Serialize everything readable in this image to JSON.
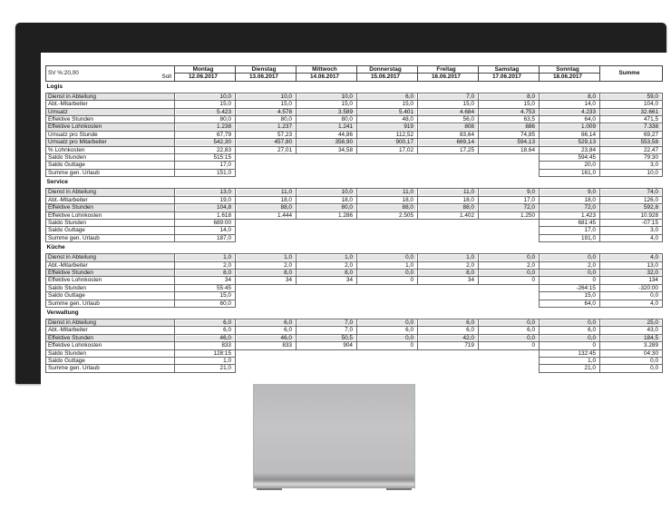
{
  "header": {
    "sv_label": "SV %:20,00",
    "soll_label": "Soll",
    "days": [
      {
        "name": "Montag",
        "date": "12.06.2017"
      },
      {
        "name": "Dienstag",
        "date": "13.06.2017"
      },
      {
        "name": "Mittwoch",
        "date": "14.06.2017"
      },
      {
        "name": "Donnerstag",
        "date": "15.06.2017"
      },
      {
        "name": "Freitag",
        "date": "16.06.2017"
      },
      {
        "name": "Samstag",
        "date": "17.06.2017"
      },
      {
        "name": "Sonntag",
        "date": "18.06.2017"
      }
    ],
    "sum_label": "Summe"
  },
  "sections": [
    {
      "title": "Logis",
      "rows": [
        {
          "label": "Dienst in Abteilung",
          "values": [
            "10,0",
            "10,0",
            "10,0",
            "6,0",
            "7,0",
            "8,0",
            "8,0",
            "59,0"
          ]
        },
        {
          "label": "Abt.-Mitarbeiter",
          "values": [
            "15,0",
            "15,0",
            "15,0",
            "15,0",
            "15,0",
            "15,0",
            "14,0",
            "104,0"
          ]
        },
        {
          "label": "Umsatz",
          "values": [
            "5.423",
            "4.578",
            "3.589",
            "5.401",
            "4.684",
            "4.753",
            "4.233",
            "32.661"
          ]
        },
        {
          "label": "Effektive Stunden",
          "values": [
            "80,0",
            "80,0",
            "80,0",
            "48,0",
            "56,0",
            "63,5",
            "64,0",
            "471,5"
          ]
        },
        {
          "label": "Effektive Lohnkosten",
          "values": [
            "1.238",
            "1.237",
            "1.241",
            "919",
            "808",
            "886",
            "1.009",
            "7.338"
          ]
        },
        {
          "label": "Umsatz pro Stunde",
          "values": [
            "67,79",
            "57,23",
            "44,86",
            "112,52",
            "83,64",
            "74,85",
            "66,14",
            "69,27"
          ]
        },
        {
          "label": "Umsatz pro Mitarbeiter",
          "values": [
            "542,30",
            "457,80",
            "358,90",
            "900,17",
            "669,14",
            "594,13",
            "529,13",
            "553,58"
          ]
        },
        {
          "label": "% Lohnkosten",
          "values": [
            "22,83",
            "27,01",
            "34,58",
            "17,02",
            "17,25",
            "18,64",
            "23,84",
            "22,47"
          ]
        }
      ],
      "saldo": [
        {
          "label": "Saldo Stunden",
          "soll": "515:15",
          "sonntag": "594:45",
          "summe": "79:30"
        },
        {
          "label": "Saldo Guttage",
          "soll": "17,0",
          "sonntag": "20,0",
          "summe": "3,0"
        },
        {
          "label": "Summe gen. Urlaub",
          "soll": "151,0",
          "sonntag": "161,0",
          "summe": "10,0"
        }
      ]
    },
    {
      "title": "Service",
      "rows": [
        {
          "label": "Dienst in Abteilung",
          "values": [
            "13,0",
            "11,0",
            "10,0",
            "11,0",
            "11,0",
            "9,0",
            "9,0",
            "74,0"
          ]
        },
        {
          "label": "Abt.-Mitarbeiter",
          "values": [
            "19,0",
            "18,0",
            "18,0",
            "18,0",
            "18,0",
            "17,0",
            "18,0",
            "126,0"
          ]
        },
        {
          "label": "Effektive Stunden",
          "values": [
            "104,8",
            "88,0",
            "80,0",
            "88,0",
            "88,0",
            "72,0",
            "72,0",
            "592,8"
          ]
        },
        {
          "label": "Effektive Lohnkosten",
          "values": [
            "1.618",
            "1.444",
            "1.286",
            "2.505",
            "1.402",
            "1.250",
            "1.423",
            "10.928"
          ]
        }
      ],
      "saldo": [
        {
          "label": "Saldo Stunden",
          "soll": "689:00",
          "sonntag": "681:45",
          "summe": "-07:15"
        },
        {
          "label": "Saldo Guttage",
          "soll": "14,0",
          "sonntag": "17,0",
          "summe": "3,0"
        },
        {
          "label": "Summe gen. Urlaub",
          "soll": "187,0",
          "sonntag": "191,0",
          "summe": "4,0"
        }
      ]
    },
    {
      "title": "Küche",
      "rows": [
        {
          "label": "Dienst in Abteilung",
          "values": [
            "1,0",
            "1,0",
            "1,0",
            "0,0",
            "1,0",
            "0,0",
            "0,0",
            "4,0"
          ]
        },
        {
          "label": "Abt.-Mitarbeiter",
          "values": [
            "2,0",
            "2,0",
            "2,0",
            "1,0",
            "2,0",
            "2,0",
            "2,0",
            "13,0"
          ]
        },
        {
          "label": "Effektive Stunden",
          "values": [
            "8,0",
            "8,0",
            "8,0",
            "0,0",
            "8,0",
            "0,0",
            "0,0",
            "32,0"
          ]
        },
        {
          "label": "Effektive Lohnkosten",
          "values": [
            "34",
            "34",
            "34",
            "0",
            "34",
            "0",
            "0",
            "134"
          ]
        }
      ],
      "saldo": [
        {
          "label": "Saldo Stunden",
          "soll": "55:45",
          "sonntag": "-264:15",
          "summe": "-320:00"
        },
        {
          "label": "Saldo Guttage",
          "soll": "15,0",
          "sonntag": "15,0",
          "summe": "0,0"
        },
        {
          "label": "Summe gen. Urlaub",
          "soll": "60,0",
          "sonntag": "64,0",
          "summe": "4,0"
        }
      ]
    },
    {
      "title": "Verwaltung",
      "rows": [
        {
          "label": "Dienst in Abteilung",
          "values": [
            "6,0",
            "6,0",
            "7,0",
            "0,0",
            "6,0",
            "0,0",
            "0,0",
            "25,0"
          ]
        },
        {
          "label": "Abt.-Mitarbeiter",
          "values": [
            "6,0",
            "6,0",
            "7,0",
            "6,0",
            "6,0",
            "6,0",
            "6,0",
            "43,0"
          ]
        },
        {
          "label": "Effektive Stunden",
          "values": [
            "46,0",
            "46,0",
            "50,5",
            "0,0",
            "42,0",
            "0,0",
            "0,0",
            "184,5"
          ]
        },
        {
          "label": "Effektive Lohnkosten",
          "values": [
            "833",
            "833",
            "904",
            "0",
            "719",
            "0",
            "0",
            "3.289"
          ]
        }
      ],
      "saldo": [
        {
          "label": "Saldo Stunden",
          "soll": "128:15",
          "sonntag": "132:45",
          "summe": "04:30"
        },
        {
          "label": "Saldo Guttage",
          "soll": "1,0",
          "sonntag": "1,0",
          "summe": "0,0"
        },
        {
          "label": "Summe gen. Urlaub",
          "soll": "21,0",
          "sonntag": "21,0",
          "summe": "0,0"
        }
      ]
    }
  ]
}
